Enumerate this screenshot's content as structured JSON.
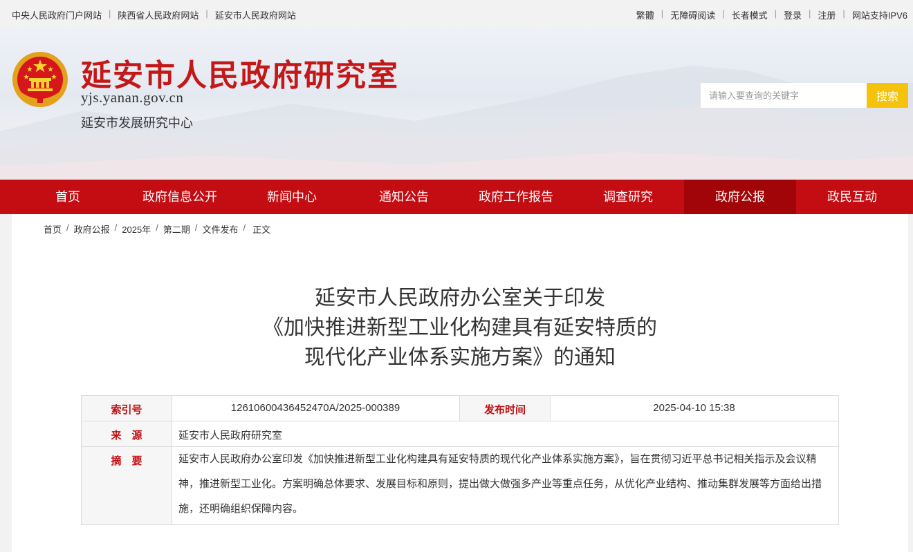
{
  "top_links": {
    "left": [
      "中央人民政府门户网站",
      "陕西省人民政府网站",
      "延安市人民政府网站"
    ],
    "right": [
      "繁體",
      "无障碍阅读",
      "长者模式",
      "登录",
      "注册",
      "网站支持IPV6"
    ]
  },
  "header": {
    "title": "延安市人民政府研究室",
    "domain": "yjs.yanan.gov.cn",
    "subtitle": "延安市发展研究中心",
    "search_placeholder": "请输入要查询的关键字",
    "search_button": "搜索"
  },
  "nav": {
    "items": [
      "首页",
      "政府信息公开",
      "新闻中心",
      "通知公告",
      "政府工作报告",
      "调查研究",
      "政府公报",
      "政民互动"
    ],
    "active": "政府公报"
  },
  "breadcrumb": [
    "首页",
    "政府公报",
    "2025年",
    "第二期",
    "文件发布",
    "正文"
  ],
  "article": {
    "title_lines": [
      "延安市人民政府办公室关于印发",
      "《加快推进新型工业化构建具有延安特质的",
      "现代化产业体系实施方案》的通知"
    ]
  },
  "meta": {
    "index_label": "索引号",
    "index_value": "12610600436452470A/2025-000389",
    "date_label": "发布时间",
    "date_value": "2025-04-10 15:38",
    "source_label": "来　源",
    "source_value": "延安市人民政府研究室",
    "abstract_label": "摘　要",
    "abstract_value": "延安市人民政府办公室印发《加快推进新型工业化构建具有延安特质的现代化产业体系实施方案》，旨在贯彻习近平总书记相关指示及会议精神，推进新型工业化。方案明确总体要求、发展目标和原则，提出做大做强多产业等重点任务，从优化产业结构、推动集群发展等方面给出措施，还明确组织保障内容。"
  },
  "colors": {
    "primary_red": "#c40d13",
    "active_nav": "#a10508",
    "search_yellow": "#f5c20c"
  },
  "icons": {
    "emblem": "national-emblem-icon"
  }
}
